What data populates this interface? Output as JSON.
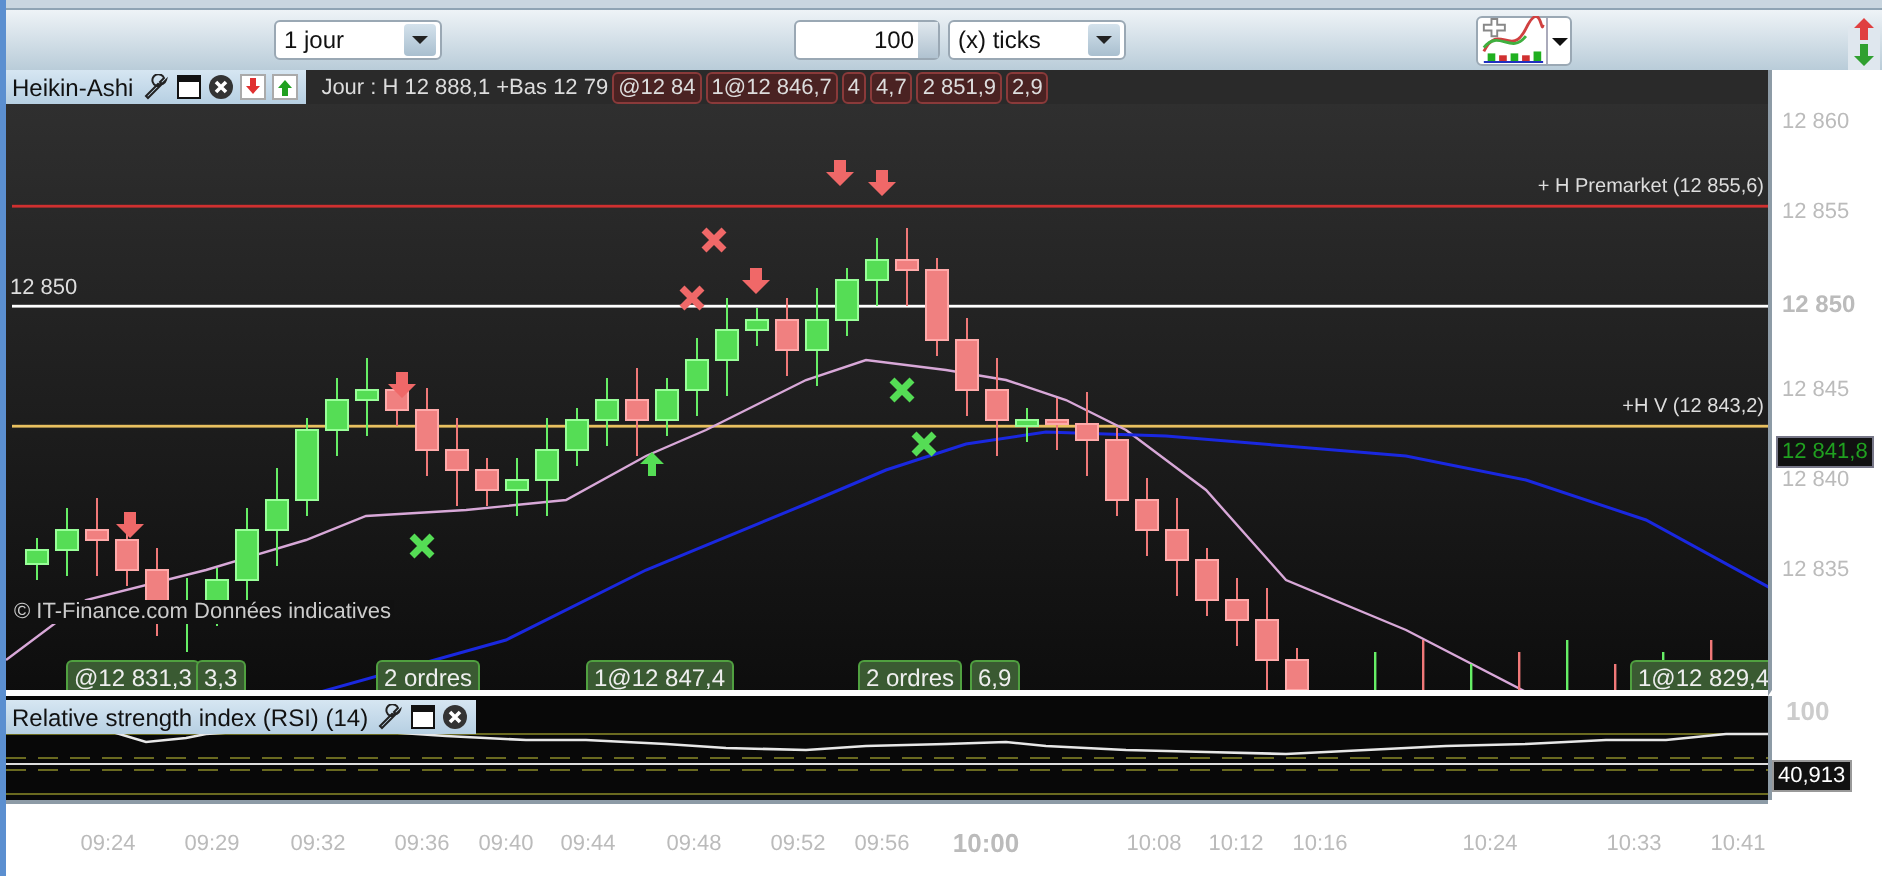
{
  "toolbar": {
    "period": "1 jour",
    "tick_count": "100",
    "tick_unit": "(x) ticks"
  },
  "chart": {
    "title": "Heikin-Ashi",
    "legend": "Jour : H 12 888,1 +Bas 12 79",
    "header_tags": [
      "@12 84",
      "1@12 846,7",
      "4",
      "4,7",
      "2 851,9",
      "2,9"
    ],
    "levels": [
      {
        "label": "+ H Premarket (12 855,6)",
        "color": "#d03030"
      },
      {
        "label": "12 850",
        "color": "#ffffff"
      },
      {
        "label": "+H V (12 843,2)",
        "color": "#e8c060"
      }
    ],
    "order_tags": [
      "@12 831,3",
      "3,3",
      "2 ordres",
      "1@12 847,4",
      "2 ordres",
      "6,9",
      "1@12 829,4"
    ],
    "watermark": "© IT-Finance.com Données indicatives",
    "price_ticks": [
      {
        "label": "12 860",
        "major": false
      },
      {
        "label": "12 855",
        "major": false
      },
      {
        "label": "12 850",
        "major": true
      },
      {
        "label": "12 845",
        "major": false
      },
      {
        "label": "12 840",
        "major": false
      },
      {
        "label": "12 835",
        "major": false
      }
    ],
    "last_price": "12 841,8"
  },
  "rsi": {
    "title": "Relative strength index (RSI) (14)",
    "top_tick": "100",
    "value": "40,913"
  },
  "time_axis": [
    {
      "label": "09:24",
      "major": false
    },
    {
      "label": "09:29",
      "major": false
    },
    {
      "label": "09:32",
      "major": false
    },
    {
      "label": "09:36",
      "major": false
    },
    {
      "label": "09:40",
      "major": false
    },
    {
      "label": "09:44",
      "major": false
    },
    {
      "label": "09:48",
      "major": false
    },
    {
      "label": "09:52",
      "major": false
    },
    {
      "label": "09:56",
      "major": false
    },
    {
      "label": "10:00",
      "major": true
    },
    {
      "label": "10:08",
      "major": false
    },
    {
      "label": "10:12",
      "major": false
    },
    {
      "label": "10:16",
      "major": false
    },
    {
      "label": "10:24",
      "major": false
    },
    {
      "label": "10:33",
      "major": false
    },
    {
      "label": "10:41",
      "major": false
    }
  ]
}
